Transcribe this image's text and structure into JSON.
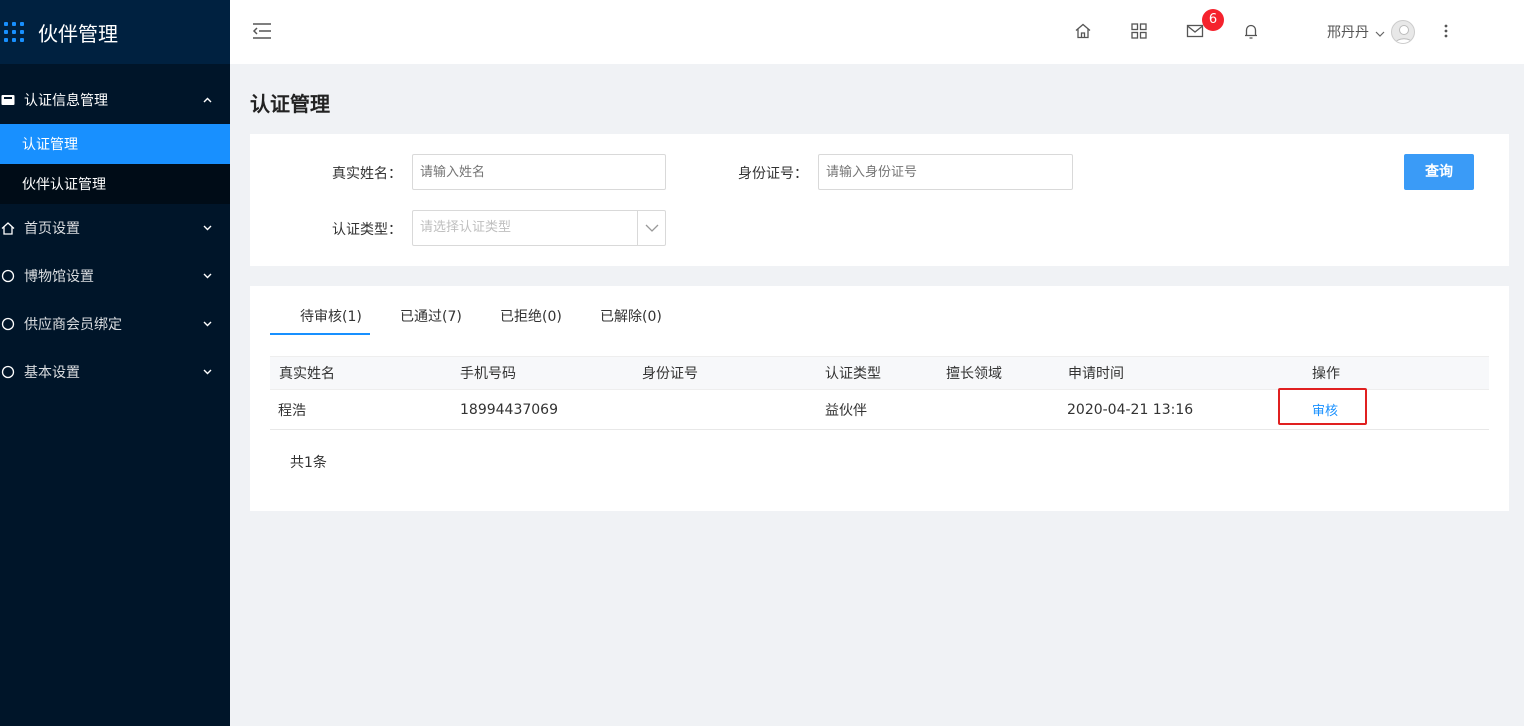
{
  "app": {
    "title": "伙伴管理"
  },
  "sidebar": {
    "groups": [
      {
        "label": "认证信息管理",
        "expanded": true,
        "children": [
          {
            "label": "认证管理",
            "active": true
          },
          {
            "label": "伙伴认证管理",
            "active": false
          }
        ]
      },
      {
        "label": "首页设置",
        "expanded": false
      },
      {
        "label": "博物馆设置",
        "expanded": false
      },
      {
        "label": "供应商会员绑定",
        "expanded": false
      },
      {
        "label": "基本设置",
        "expanded": false
      }
    ]
  },
  "header": {
    "mail_badge": "6",
    "username": "邢丹丹",
    "icons": [
      "fold-icon",
      "home-icon",
      "apps-grid-icon",
      "mail-icon",
      "bell-icon",
      "user-avatar-icon",
      "more-vertical-icon"
    ]
  },
  "page": {
    "title": "认证管理"
  },
  "filters": {
    "name_label": "真实姓名：",
    "name_placeholder": "请输入姓名",
    "id_label": "身份证号：",
    "id_placeholder": "请输入身份证号",
    "type_label": "认证类型：",
    "type_placeholder": "请选择认证类型",
    "query_label": "查询"
  },
  "tabs": [
    {
      "label": "待审核(1)",
      "active": true
    },
    {
      "label": "已通过(7)",
      "active": false
    },
    {
      "label": "已拒绝(0)",
      "active": false
    },
    {
      "label": "已解除(0)",
      "active": false
    }
  ],
  "table": {
    "headers": [
      "真实姓名",
      "手机号码",
      "身份证号",
      "认证类型",
      "擅长领域",
      "申请时间",
      "操作"
    ],
    "rows": [
      {
        "name": "程浩",
        "phone": "18994437069",
        "id_number": "",
        "type": "益伙伴",
        "field": "",
        "time": "2020-04-21 13:16",
        "action": "审核"
      }
    ],
    "total": "共1条"
  },
  "colors": {
    "sidebar_bg": "#001529",
    "accent": "#1890ff",
    "badge": "#f5222d",
    "highlight": "#e02020"
  }
}
